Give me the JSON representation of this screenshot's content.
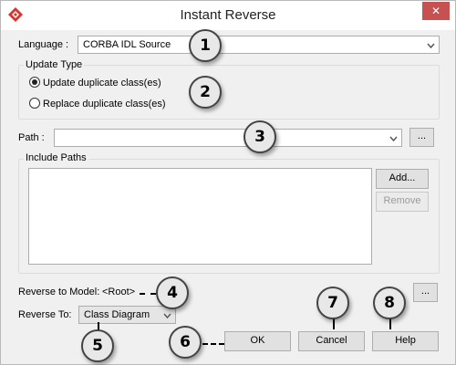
{
  "window": {
    "title": "Instant Reverse",
    "close_glyph": "✕"
  },
  "language": {
    "label": "Language :",
    "value": "CORBA IDL Source"
  },
  "update_type": {
    "legend": "Update Type",
    "options": [
      {
        "label": "Update duplicate class(es)",
        "checked": true
      },
      {
        "label": "Replace duplicate class(es)",
        "checked": false
      }
    ]
  },
  "path": {
    "label": "Path :",
    "value": "",
    "browse_label": "..."
  },
  "include_paths": {
    "legend": "Include Paths",
    "add_label": "Add...",
    "remove_label": "Remove"
  },
  "reverse_model": {
    "label": "Reverse to Model:",
    "value": "<Root>",
    "browse_label": "..."
  },
  "reverse_to": {
    "label": "Reverse To:",
    "value": "Class Diagram"
  },
  "buttons": {
    "ok": "OK",
    "cancel": "Cancel",
    "help": "Help"
  },
  "callouts": {
    "c1": "1",
    "c2": "2",
    "c3": "3",
    "c4": "4",
    "c5": "5",
    "c6": "6",
    "c7": "7",
    "c8": "8"
  },
  "colors": {
    "close": "#c75050",
    "app_icon": "#d8332c"
  }
}
